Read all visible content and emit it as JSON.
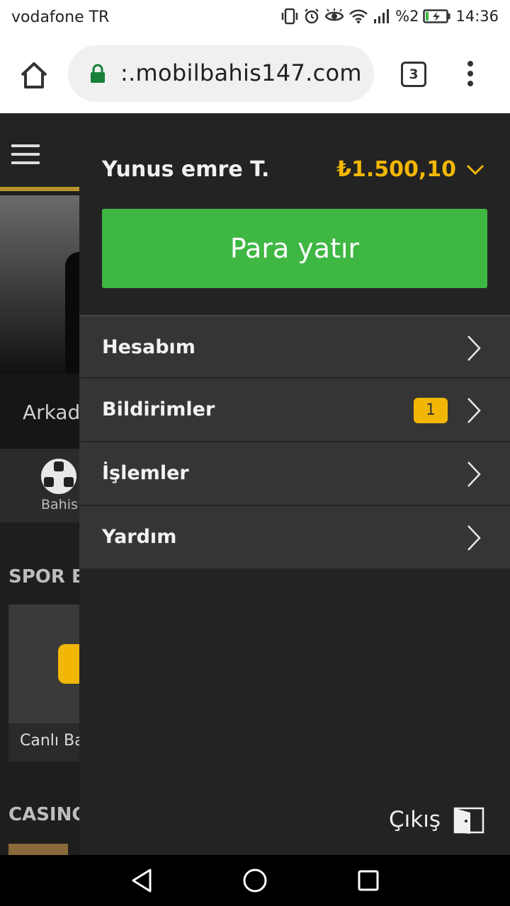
{
  "status_bar": {
    "carrier": "vodafone TR",
    "battery": "%2",
    "time": "14:36",
    "icons": [
      "vibrate-icon",
      "alarm-icon",
      "eye-icon",
      "wifi-icon",
      "signal-icon",
      "battery-charging-icon"
    ]
  },
  "browser": {
    "url": ":.mobilbahis147.com",
    "tab_count": "3",
    "icons": [
      "home-icon",
      "lock-icon",
      "kebab-menu-icon"
    ],
    "lock_color": "#188038"
  },
  "background_page": {
    "promo_text": "Arkad",
    "nav_label": "Bahis",
    "section1_title": "SPOR B",
    "card_label": "Canlı Ba",
    "section2_title": "CASINC"
  },
  "drawer": {
    "user_name": "Yunus emre T.",
    "balance": "₺1.500,10",
    "deposit_label": "Para yatır",
    "menu_items": [
      {
        "label": "Hesabım"
      },
      {
        "label": "Bildirimler",
        "badge": "1"
      },
      {
        "label": "İşlemler"
      },
      {
        "label": "Yardım"
      }
    ],
    "logout_label": "Çıkış",
    "colors": {
      "accent": "#f2b705",
      "deposit": "#3fb743",
      "background": "#232323",
      "menu_item": "#353535"
    }
  },
  "nav_bar": {
    "icons": [
      "back-icon",
      "home-circle-icon",
      "recents-icon"
    ]
  }
}
